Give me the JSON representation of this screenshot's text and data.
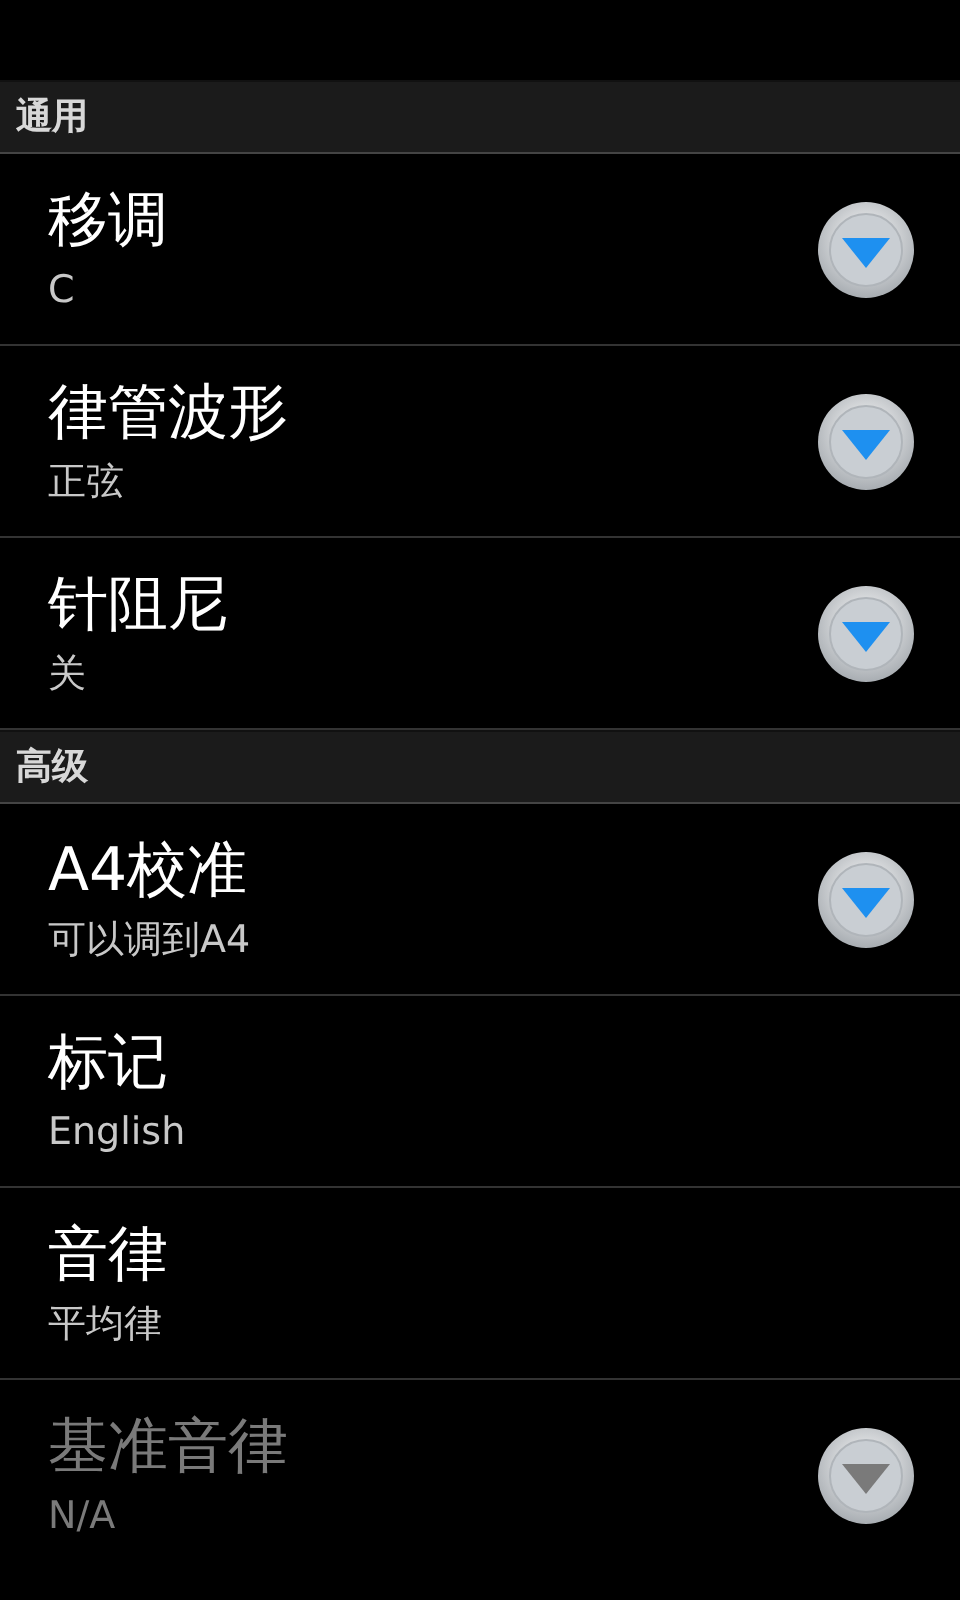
{
  "sections": [
    {
      "title": "通用",
      "items": [
        {
          "title": "移调",
          "summary": "C",
          "kind": "list",
          "disabled": false
        },
        {
          "title": "律管波形",
          "summary": "正弦",
          "kind": "list",
          "disabled": false
        },
        {
          "title": "针阻尼",
          "summary": "关",
          "kind": "list",
          "disabled": false
        }
      ]
    },
    {
      "title": "高级",
      "items": [
        {
          "title": "A4校准",
          "summary": "可以调到A4",
          "kind": "list",
          "disabled": false
        },
        {
          "title": "标记",
          "summary": "English",
          "kind": "plain",
          "disabled": false
        },
        {
          "title": "音律",
          "summary": "平均律",
          "kind": "plain",
          "disabled": false
        },
        {
          "title": "基准音律",
          "summary": "N/A",
          "kind": "list",
          "disabled": true
        }
      ]
    }
  ]
}
